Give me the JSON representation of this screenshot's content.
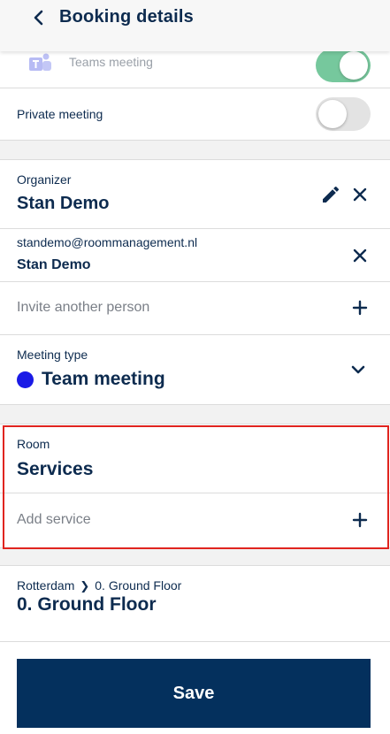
{
  "colors": {
    "primary": "#0d2b4f",
    "accent_dot": "#1a1ae6",
    "toggle_on": "#5fbf8c",
    "highlight": "#e0241f",
    "save_bg": "#04305d"
  },
  "header": {
    "title": "Booking details",
    "back_icon": "chevron-left-icon"
  },
  "teams": {
    "label": "Teams meeting",
    "icon": "teams-icon",
    "toggle": "on"
  },
  "private": {
    "label": "Private meeting",
    "toggle": "off"
  },
  "organizer": {
    "label": "Organizer",
    "name": "Stan Demo",
    "edit_icon": "pencil-icon",
    "remove_icon": "close-icon"
  },
  "attendee": {
    "email": "standemo@roommanagement.nl",
    "name": "Stan Demo",
    "remove_icon": "close-icon"
  },
  "invite": {
    "placeholder": "Invite another person",
    "add_icon": "plus-icon"
  },
  "meeting_type": {
    "label": "Meeting type",
    "value": "Team meeting",
    "dropdown_icon": "chevron-down-icon"
  },
  "room": {
    "label": "Room",
    "value": "Services"
  },
  "service": {
    "placeholder": "Add service",
    "add_icon": "plus-icon"
  },
  "location": {
    "city": "Rotterdam",
    "floor_crumb": "0. Ground Floor",
    "floor": "0. Ground Floor"
  },
  "save": {
    "label": "Save"
  }
}
